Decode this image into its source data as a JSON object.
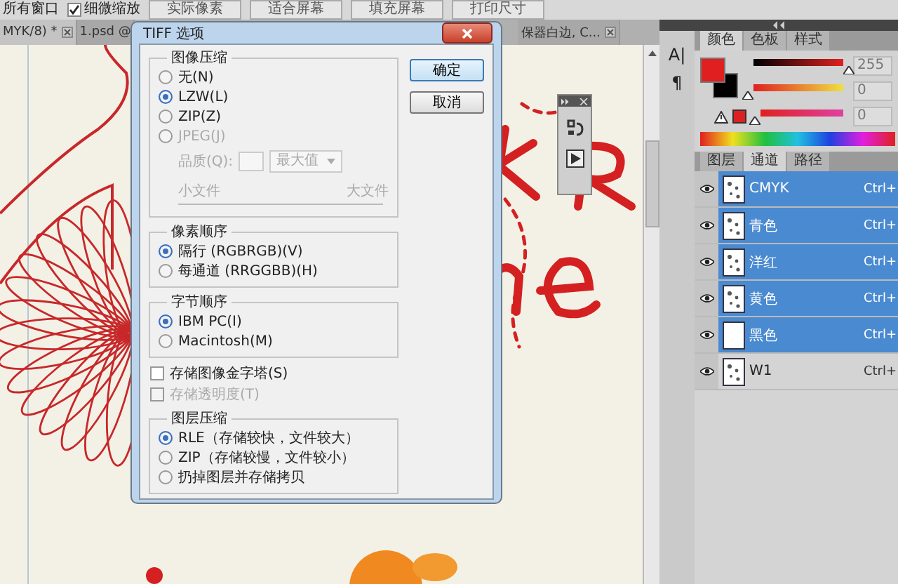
{
  "options_bar": {
    "window_label": "所有窗口",
    "zoom_checkbox": {
      "label": "细微缩放",
      "checked": true
    },
    "buttons": [
      "实际像素",
      "适合屏幕",
      "填充屏幕",
      "打印尺寸"
    ]
  },
  "doc_tabs": [
    {
      "title": "MYK/8) *",
      "selected": true,
      "closable": true
    },
    {
      "title": "1.psd @",
      "selected": false,
      "closable": false
    },
    {
      "title": "保器白边, C...",
      "selected": false,
      "closable": true
    }
  ],
  "dialog": {
    "title": "TIFF 选项",
    "buttons": [
      {
        "label": "确定",
        "default": true
      },
      {
        "label": "取消",
        "default": false
      }
    ],
    "sections": [
      {
        "kind": "radio_group",
        "title": "图像压缩",
        "options": [
          {
            "label": "无(N)",
            "selected": false,
            "disabled": false
          },
          {
            "label": "LZW(L)",
            "selected": true,
            "disabled": false
          },
          {
            "label": "ZIP(Z)",
            "selected": false,
            "disabled": false
          },
          {
            "label": "JPEG(J)",
            "selected": false,
            "disabled": true
          }
        ],
        "quality": {
          "label": "品质(Q):",
          "dropdown": "最大值",
          "disabled": true
        },
        "size_slider": {
          "min_label": "小文件",
          "max_label": "大文件"
        }
      },
      {
        "kind": "radio_group",
        "title": "像素顺序",
        "options": [
          {
            "label": "隔行 (RGBRGB)(V)",
            "selected": true,
            "disabled": false
          },
          {
            "label": "每通道 (RRGGBB)(H)",
            "selected": false,
            "disabled": false
          }
        ]
      },
      {
        "kind": "radio_group",
        "title": "字节顺序",
        "options": [
          {
            "label": "IBM PC(I)",
            "selected": true,
            "disabled": false
          },
          {
            "label": "Macintosh(M)",
            "selected": false,
            "disabled": false
          }
        ]
      },
      {
        "kind": "checkboxes",
        "options": [
          {
            "label": "存储图像金字塔(S)",
            "checked": false,
            "disabled": false
          },
          {
            "label": "存储透明度(T)",
            "checked": false,
            "disabled": true
          }
        ]
      },
      {
        "kind": "radio_group",
        "title": "图层压缩",
        "options": [
          {
            "label": "RLE（存储较快，文件较大）",
            "selected": true,
            "disabled": false
          },
          {
            "label": "ZIP（存储较慢，文件较小）",
            "selected": false,
            "disabled": false
          },
          {
            "label": "扔掉图层并存储拷贝",
            "selected": false,
            "disabled": false
          }
        ]
      }
    ]
  },
  "dock_icons": [
    "A|",
    "¶"
  ],
  "color_panel": {
    "tabs": [
      {
        "label": "颜色",
        "selected": true
      },
      {
        "label": "色板",
        "selected": false
      },
      {
        "label": "样式",
        "selected": false
      }
    ],
    "sliders": [
      {
        "level": 1,
        "value": "255"
      },
      {
        "level": 0,
        "value": "0"
      },
      {
        "level": 0,
        "value": "0"
      }
    ]
  },
  "channels_panel": {
    "tabs": [
      {
        "label": "图层",
        "selected": false
      },
      {
        "label": "通道",
        "selected": true
      },
      {
        "label": "路径",
        "selected": false
      }
    ],
    "channels": [
      {
        "name": "CMYK",
        "shortcut": "Ctrl+",
        "selected": true,
        "visible": true
      },
      {
        "name": "青色",
        "shortcut": "Ctrl+",
        "selected": true,
        "visible": true
      },
      {
        "name": "洋红",
        "shortcut": "Ctrl+",
        "selected": true,
        "visible": true
      },
      {
        "name": "黄色",
        "shortcut": "Ctrl+",
        "selected": true,
        "visible": true
      },
      {
        "name": "黑色",
        "shortcut": "Ctrl+",
        "selected": true,
        "visible": true
      },
      {
        "name": "W1",
        "shortcut": "Ctrl+",
        "selected": false,
        "visible": true
      }
    ]
  }
}
